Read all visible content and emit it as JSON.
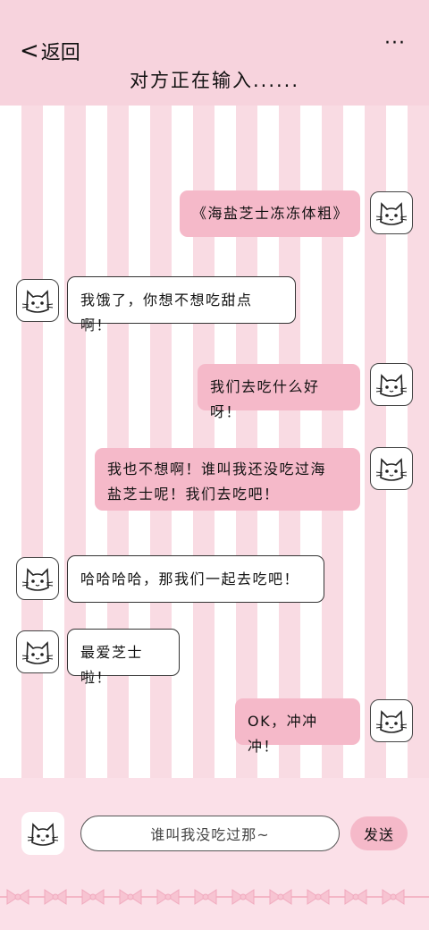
{
  "header": {
    "back_label": "返回",
    "back_symbol": "<",
    "more_label": "···",
    "title": "对方正在输入......"
  },
  "messages": [
    {
      "from": "me",
      "text": "《海盐芝士冻冻体粗》"
    },
    {
      "from": "them",
      "text": "我饿了，你想不想吃甜点啊！"
    },
    {
      "from": "me",
      "text": "我们去吃什么好呀！"
    },
    {
      "from": "me",
      "line1": "我也不想啊！谁叫我还没吃过海",
      "line2": "盐芝士呢！我们去吃吧！"
    },
    {
      "from": "them",
      "text": "哈哈哈哈，那我们一起去吃吧！"
    },
    {
      "from": "them",
      "text": "最爱芝士啦！"
    },
    {
      "from": "me",
      "text": "OK，冲冲冲！"
    }
  ],
  "composer": {
    "input_value": "谁叫我没吃过那~",
    "send_label": "发送"
  },
  "colors": {
    "accent_pink": "#f5b9c9",
    "header_pink": "#f7d3dd",
    "stripe_pink": "#f9dbe3"
  }
}
